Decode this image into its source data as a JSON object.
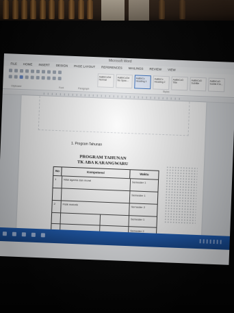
{
  "photo": {
    "subject": "Laptop screen showing a word processor document"
  },
  "word": {
    "window_title": "Microsoft Word",
    "menu": [
      "FILE",
      "HOME",
      "INSERT",
      "DESIGN",
      "PAGE LAYOUT",
      "REFERENCES",
      "MAILINGS",
      "REVIEW",
      "VIEW"
    ],
    "styles": [
      "AaBbCcDd",
      "AaBbCcDd",
      "AaBbCc",
      "AaBbCc",
      "AaBbCcD",
      "AaBbCcD",
      "AaBbCcD",
      "AaBbCcD"
    ],
    "style_names": [
      "Normal",
      "No Spac...",
      "Heading 1",
      "Heading 2",
      "Title",
      "Subtitle",
      "Subtle Em...",
      "Emphasis"
    ],
    "ribbon_labels": [
      "Clipboard",
      "Font",
      "Paragraph",
      "Styles"
    ]
  },
  "document": {
    "subheading": "1. Program Tahunan",
    "title_line1": "PROGRAM TAHUNAN",
    "title_line2": "TK ABA KARANGWARU",
    "table": {
      "headers": [
        "No",
        "Kompetensi",
        "Waktu"
      ],
      "rows": [
        {
          "no": "1",
          "text": "Nilai agama dan moral",
          "time": "Semester 1"
        },
        {
          "no": "",
          "text": "",
          "time": "Semester 1"
        },
        {
          "no": "2",
          "text": "Fisik motorik",
          "time": "Semester 2"
        },
        {
          "no": "",
          "text": "",
          "time": "Semester 1"
        },
        {
          "no": "",
          "text": "",
          "time": "Semester 2"
        }
      ]
    }
  },
  "colors": {
    "taskbar": "#1f5fb8",
    "selected_style": "#3f78c8"
  }
}
